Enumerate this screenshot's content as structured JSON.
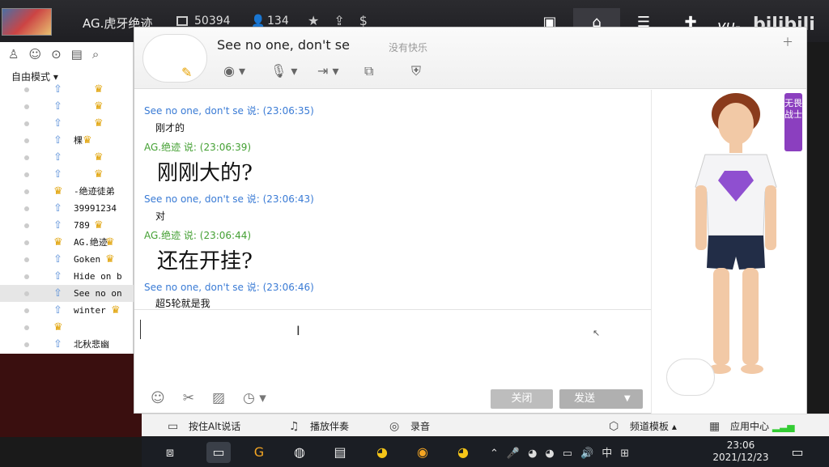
{
  "topbar": {
    "room_title": "AG.虎牙绝迹",
    "room_id": "50394",
    "people_count": "134",
    "watermark_user": "__yu-",
    "watermark_site": "bilibili",
    "icons": [
      "person-icon",
      "star-icon",
      "share-icon",
      "dollar-icon"
    ],
    "right_icons": [
      "window-icon",
      "home-icon",
      "list-icon",
      "game-icon"
    ]
  },
  "left_panel": {
    "mode": "自由模式 ▾",
    "members": [
      {
        "name": "",
        "icon": "up-arrow",
        "badge": "♛"
      },
      {
        "name": "",
        "icon": "up-arrow",
        "badge": "♛"
      },
      {
        "name": "",
        "icon": "up-arrow",
        "badge": "♛"
      },
      {
        "name": "棵",
        "icon": "up-arrow",
        "badge": "♛"
      },
      {
        "name": "",
        "icon": "up-arrow",
        "badge": "♛"
      },
      {
        "name": "",
        "icon": "up-arrow",
        "badge": "♛"
      },
      {
        "name": "-绝迹徒弟",
        "icon": "crown",
        "badge": ""
      },
      {
        "name": "39991234",
        "icon": "up-arrow",
        "badge": ""
      },
      {
        "name": "789",
        "icon": "up-arrow",
        "badge": "♛"
      },
      {
        "name": "AG.绝迹",
        "icon": "crown",
        "badge": "♛"
      },
      {
        "name": "Goken",
        "icon": "up-arrow",
        "badge": "♛"
      },
      {
        "name": "Hide on b",
        "icon": "up-arrow",
        "badge": ""
      },
      {
        "name": "See no on",
        "icon": "up-arrow",
        "badge": ""
      },
      {
        "name": "winter",
        "icon": "up-arrow",
        "badge": "♛"
      },
      {
        "name": "",
        "icon": "crown",
        "badge": ""
      },
      {
        "name": "北秋悲幽",
        "icon": "up-arrow",
        "badge": ""
      }
    ]
  },
  "chat": {
    "contact_name": "See no one, don't se",
    "status": "没有快乐",
    "messages": [
      {
        "header": "See no one, don't se 说: (23:06:35)",
        "text": "刚才的",
        "color": "blue",
        "big": false
      },
      {
        "header": "AG.绝迹 说: (23:06:39)",
        "text": "刚刚大的?",
        "color": "green",
        "big": true
      },
      {
        "header": "See no one, don't se 说: (23:06:43)",
        "text": "对",
        "color": "blue",
        "big": false
      },
      {
        "header": "AG.绝迹 说: (23:06:44)",
        "text": "还在开挂?",
        "color": "green",
        "big": true
      },
      {
        "header": "See no one, don't se 说: (23:06:46)",
        "text": "超5轮就是我",
        "color": "blue",
        "big": false
      }
    ],
    "close_label": "关闭",
    "send_label": "发送",
    "profile_tag": "无畏战士"
  },
  "appbar": {
    "ptt": "按住Alt说话",
    "music": "播放伴奏",
    "record": "录音",
    "template": "频道模板",
    "app_center": "应用中心"
  },
  "taskbar": {
    "time": "23:06",
    "date": "2021/12/23",
    "ime": "中"
  },
  "colors": {
    "blue_name": "#3a7bd5",
    "green_name": "#44a033",
    "tag_purple": "#8b3fbf"
  }
}
